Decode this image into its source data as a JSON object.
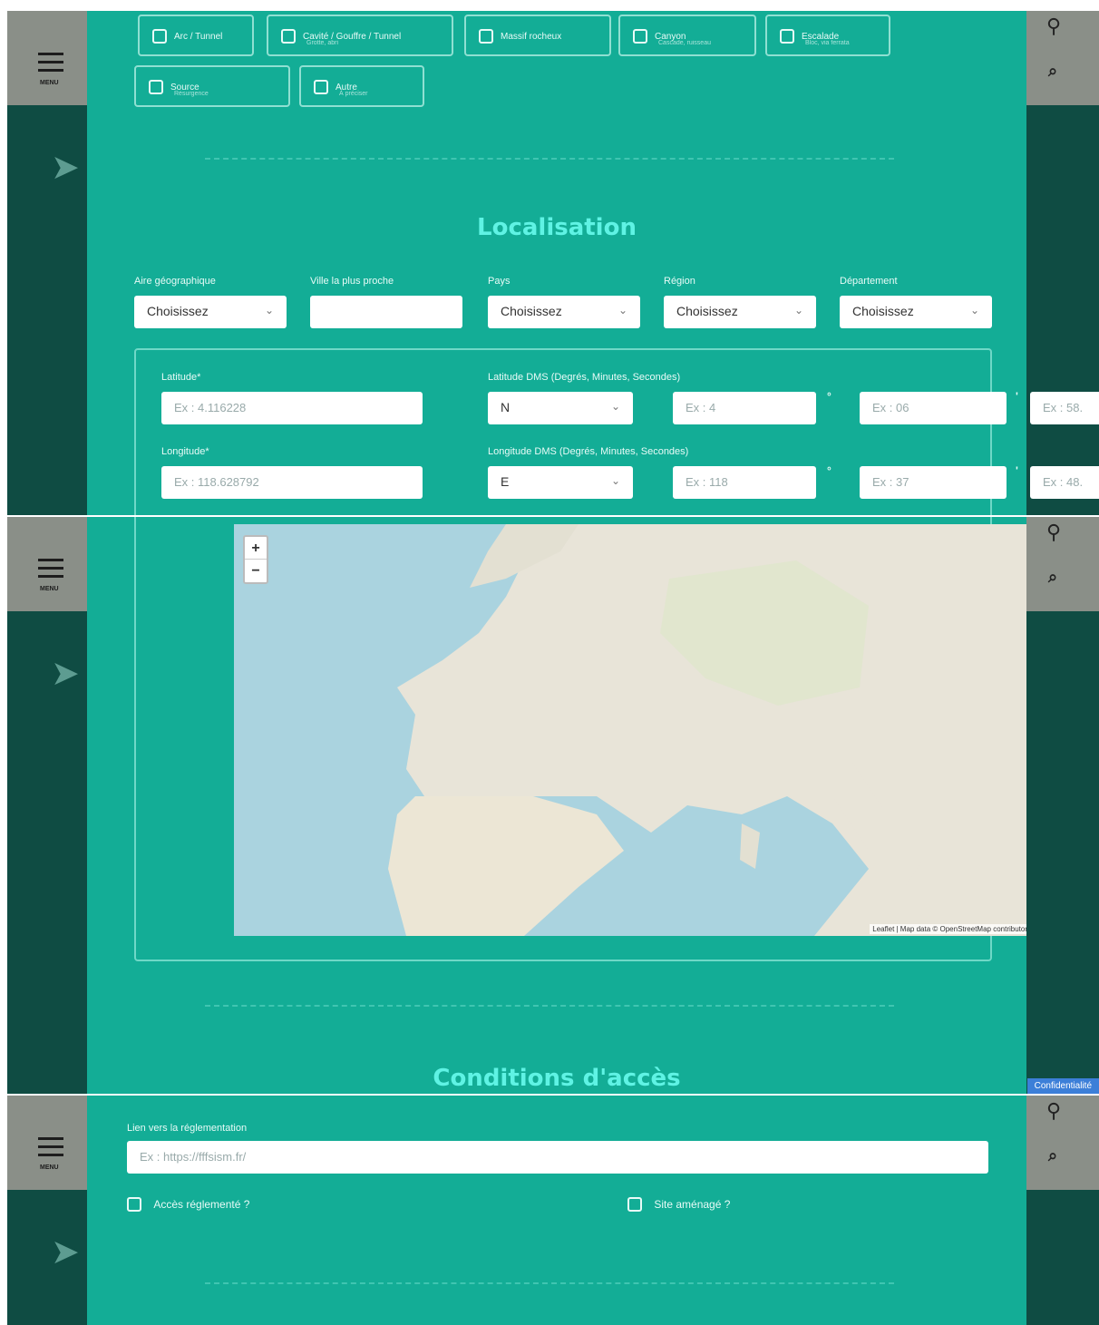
{
  "nav": {
    "menu_label": "MENU"
  },
  "types": [
    {
      "label": "Arc / Tunnel",
      "sub": ""
    },
    {
      "label": "Cavité / Gouffre / Tunnel",
      "sub": "Grotte, abri"
    },
    {
      "label": "Massif rocheux",
      "sub": ""
    },
    {
      "label": "Canyon",
      "sub": "Cascade, ruisseau"
    },
    {
      "label": "Escalade",
      "sub": "Bloc, via ferrata"
    },
    {
      "label": "Source",
      "sub": "Résurgence"
    },
    {
      "label": "Autre",
      "sub": "À préciser"
    }
  ],
  "localisation": {
    "title": "Localisation",
    "fields": {
      "aire_label": "Aire géographique",
      "ville_label": "Ville la plus proche",
      "pays_label": "Pays",
      "region_label": "Région",
      "departement_label": "Département",
      "placeholder_select": "Choisissez"
    },
    "latitude_label": "Latitude*",
    "latitude_placeholder": "Ex : 4.116228",
    "lat_dms_label": "Latitude DMS (Degrés, Minutes, Secondes)",
    "lat_dir": "N",
    "lat_deg": "Ex : 4",
    "lat_min": "Ex : 06",
    "lat_sec": "Ex : 58.",
    "longitude_label": "Longitude*",
    "longitude_placeholder": "Ex : 118.628792",
    "lon_dms_label": "Longitude DMS (Degrés, Minutes, Secondes)",
    "lon_dir": "E",
    "lon_deg": "Ex : 118",
    "lon_min": "Ex : 37",
    "lon_sec": "Ex : 48.",
    "unit_deg": "°",
    "unit_min": "'",
    "zoom_in": "+",
    "zoom_out": "−",
    "attribution": "Leaflet | Map data © OpenStreetMap contributors"
  },
  "acces": {
    "title": "Conditions d'accès",
    "lien_label": "Lien vers la réglementation",
    "lien_placeholder": "Ex : https://fffsism.fr/",
    "acces_reglemente": "Accès réglementé ?",
    "site_amenage": "Site aménagé ?"
  },
  "cookie_label": "Confidentialité",
  "colors": {
    "panel": "#13ad96",
    "accent_title": "#5ff3e4",
    "side": "#0f4c43"
  }
}
